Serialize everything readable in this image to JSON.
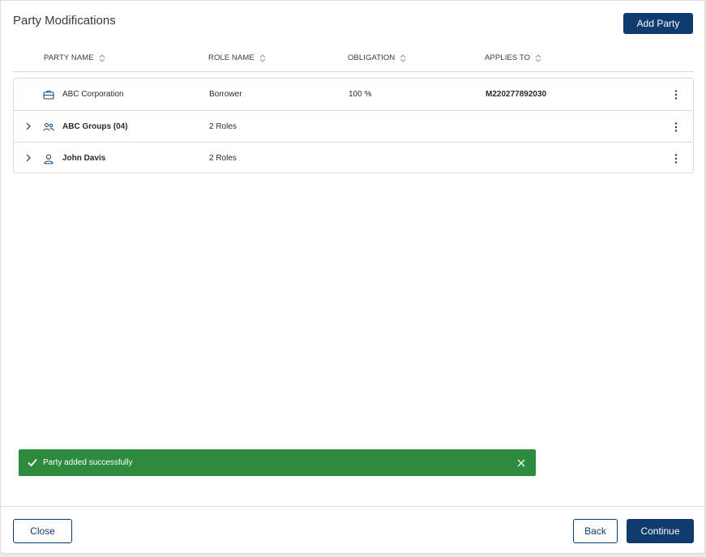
{
  "header": {
    "title": "Party Modifications",
    "add_party_label": "Add Party"
  },
  "columns": [
    "PARTY NAME",
    "ROLE NAME",
    "OBLIGATION",
    "APPLIES TO"
  ],
  "rows": [
    {
      "type": "organization",
      "icon": "briefcase-icon",
      "expandable": false,
      "name": "ABC Corporation",
      "role": "Borrower",
      "obligation": "100 %",
      "applies_to": "M220277892030"
    },
    {
      "type": "group",
      "icon": "users-icon",
      "expandable": true,
      "name": "ABC Groups (04)",
      "role": "2 Roles",
      "obligation": "",
      "applies_to": ""
    },
    {
      "type": "person",
      "icon": "user-icon",
      "expandable": true,
      "name": "John Davis",
      "role": "2 Roles",
      "obligation": "",
      "applies_to": ""
    }
  ],
  "toast": {
    "message": "Party added successfully",
    "color": "#2e8b3d"
  },
  "footer": {
    "close_label": "Close",
    "back_label": "Back",
    "continue_label": "Continue"
  },
  "colors": {
    "primary": "#0f3b6e",
    "link": "#1b4a85",
    "success": "#2e8b3d"
  }
}
